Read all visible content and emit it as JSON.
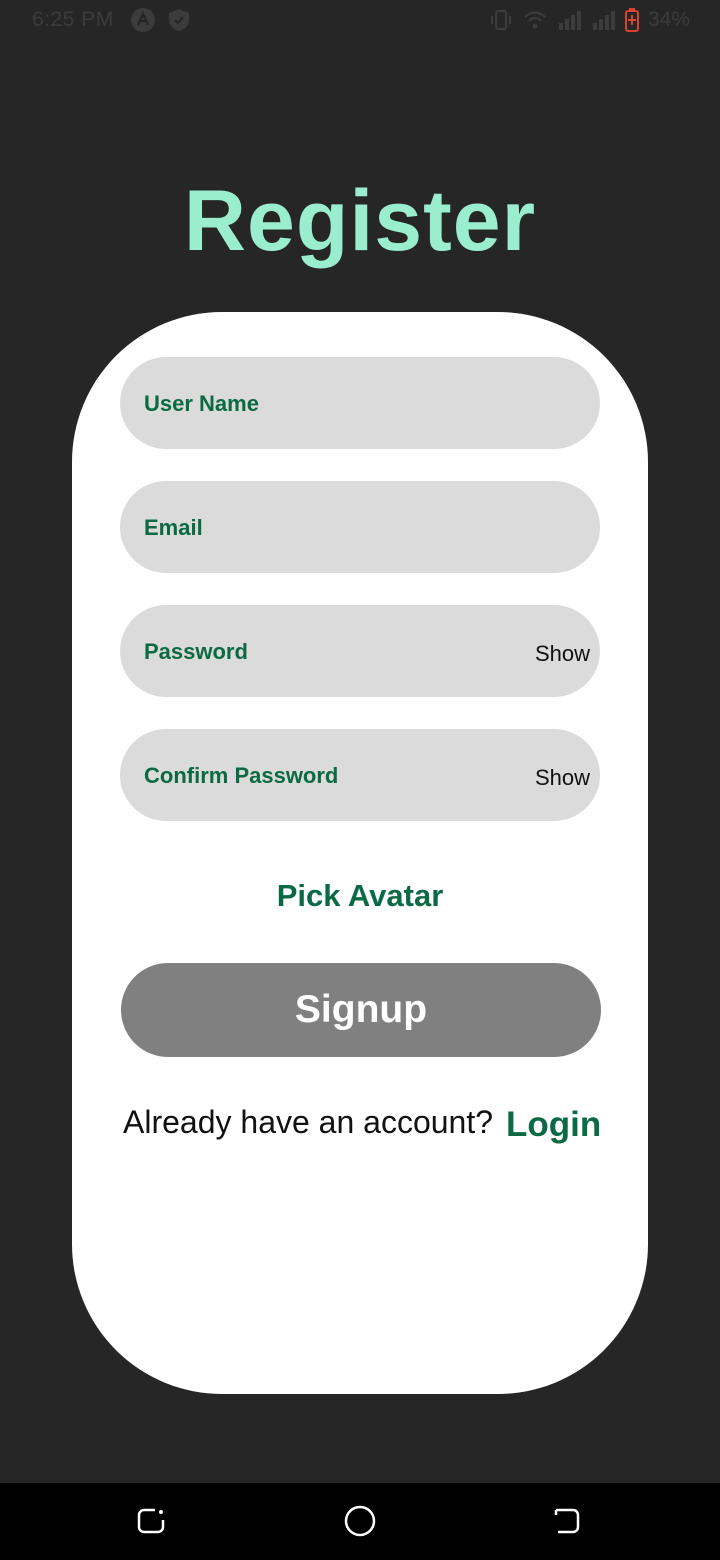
{
  "status_bar": {
    "time": "6:25 PM",
    "battery": "34%",
    "icons": [
      "android-icon",
      "shield-icon",
      "vibrate-icon",
      "wifi-icon",
      "signal-icon",
      "signal-icon",
      "battery-icon"
    ]
  },
  "page": {
    "title": "Register"
  },
  "form": {
    "username_placeholder": "User Name",
    "email_placeholder": "Email",
    "password_placeholder": "Password",
    "confirm_password_placeholder": "Confirm Password",
    "show_label": "Show",
    "pick_avatar_label": "Pick Avatar",
    "signup_label": "Signup",
    "already_text": "Already have an account?",
    "login_label": "Login"
  },
  "nav_bar": {
    "icons": [
      "recents-icon",
      "home-icon",
      "back-icon"
    ]
  },
  "colors": {
    "background": "#262626",
    "title": "#9aeecf",
    "accent_green": "#0b6a43",
    "field_bg": "#dbdbdb",
    "button_bg": "#808080"
  }
}
